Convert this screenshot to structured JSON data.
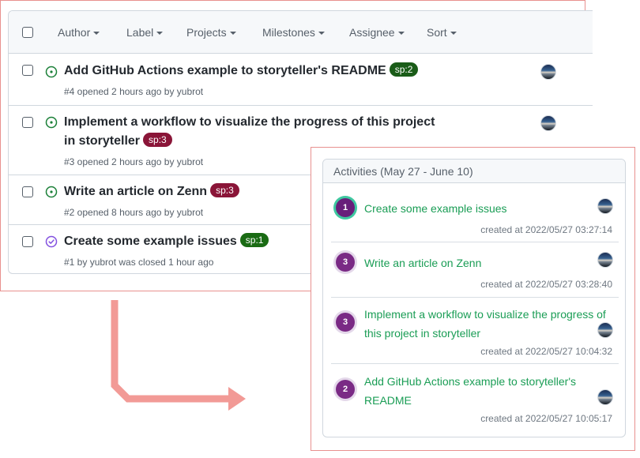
{
  "issues_panel": {
    "filters": [
      "Author",
      "Label",
      "Projects",
      "Milestones",
      "Assignee",
      "Sort"
    ],
    "issues": [
      {
        "title": "Add GitHub Actions example to storyteller's README",
        "label": "sp:2",
        "label_color": "#1a5c18",
        "meta": "#4 opened 2 hours ago by yubrot",
        "state": "open"
      },
      {
        "title": "Implement a workflow to visualize the progress of this project in storyteller",
        "label": "sp:3",
        "label_color": "#8a1538",
        "meta": "#3 opened 2 hours ago by yubrot",
        "state": "open"
      },
      {
        "title": "Write an article on Zenn",
        "label": "sp:3",
        "label_color": "#8a1538",
        "meta": "#2 opened 8 hours ago by yubrot",
        "state": "open"
      },
      {
        "title": "Create some example issues",
        "label": "sp:1",
        "label_color": "#1a6b14",
        "meta": "#1 by yubrot was closed 1 hour ago",
        "state": "closed"
      }
    ]
  },
  "activities_panel": {
    "title": "Activities (May 27 - June 10)",
    "items": [
      {
        "sp": "1",
        "title": "Create some example issues",
        "time": "created at 2022/05/27 03:27:14",
        "active": true
      },
      {
        "sp": "3",
        "title": "Write an article on Zenn",
        "time": "created at 2022/05/27 03:28:40",
        "active": false
      },
      {
        "sp": "3",
        "title": "Implement a workflow to visualize the progress of this project in storyteller",
        "time": "created at 2022/05/27 10:04:32",
        "active": false
      },
      {
        "sp": "2",
        "title": "Add GitHub Actions example to storyteller's README",
        "time": "created at 2022/05/27 10:05:17",
        "active": false
      }
    ]
  },
  "colors": {
    "frame_border": "#e8918f",
    "arrow": "#f29a96",
    "open_icon": "#1a7f37",
    "closed_icon": "#8250df",
    "activity_link": "#1a9d55",
    "sp_badge": "#7a2a85",
    "active_ring": "#3fc8a0"
  }
}
